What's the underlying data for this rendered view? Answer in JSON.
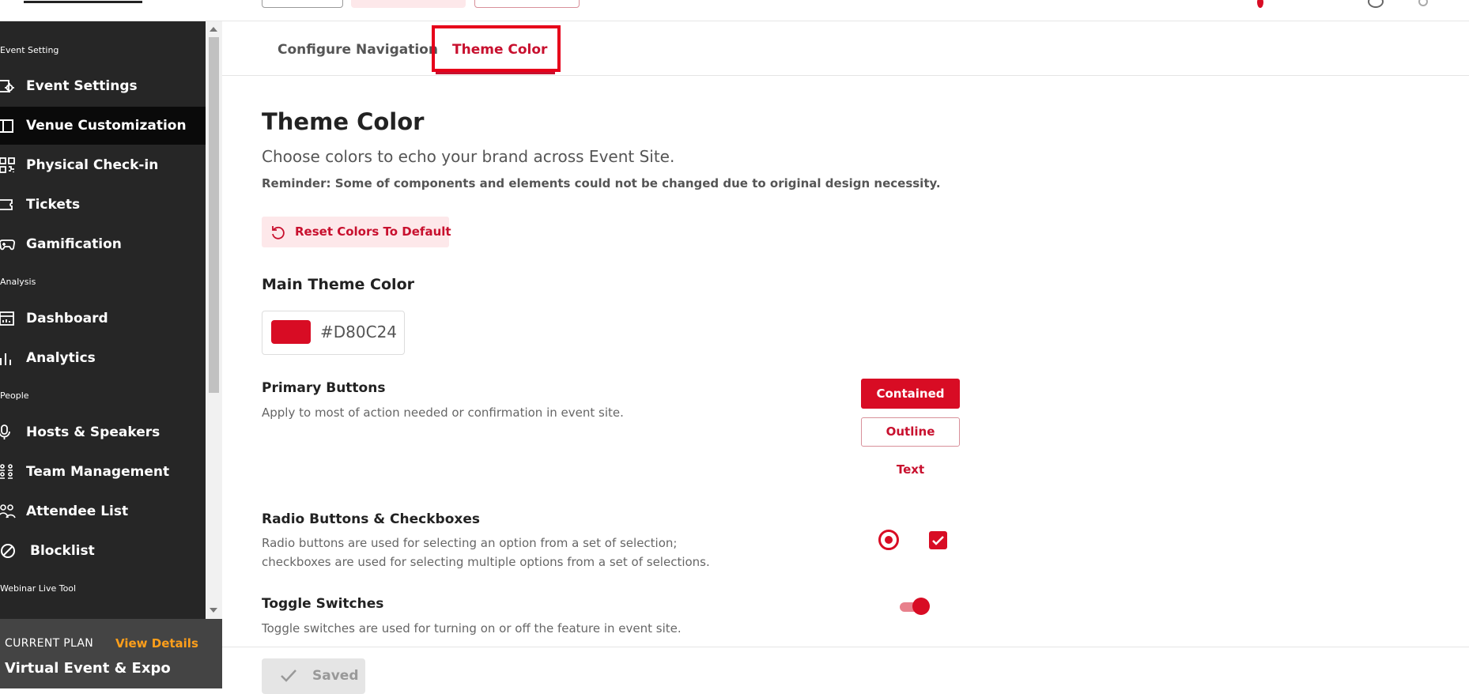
{
  "sidebar": {
    "sections": [
      {
        "label": "Event Setting"
      },
      {
        "label": "Analysis"
      },
      {
        "label": "People"
      },
      {
        "label": "Webinar Live Tool"
      }
    ],
    "items": [
      {
        "label": "Event Settings",
        "icon": "settings-calendar-icon"
      },
      {
        "label": "Venue Customization",
        "icon": "layout-icon",
        "active": true
      },
      {
        "label": "Physical Check-in",
        "icon": "qr-code-icon"
      },
      {
        "label": "Tickets",
        "icon": "ticket-icon"
      },
      {
        "label": "Gamification",
        "icon": "gamepad-icon"
      },
      {
        "label": "Dashboard",
        "icon": "dashboard-icon"
      },
      {
        "label": "Analytics",
        "icon": "bar-chart-icon"
      },
      {
        "label": "Hosts & Speakers",
        "icon": "microphone-icon"
      },
      {
        "label": "Team Management",
        "icon": "team-icon"
      },
      {
        "label": "Attendee List",
        "icon": "attendees-icon"
      },
      {
        "label": "Blocklist",
        "icon": "block-icon"
      }
    ]
  },
  "plan": {
    "current_label": "CURRENT PLAN",
    "view_details": "View Details",
    "name": "Virtual Event & Expo"
  },
  "tabs": [
    {
      "label": "Configure Navigation"
    },
    {
      "label": "Theme Color",
      "active": true
    }
  ],
  "main": {
    "title": "Theme Color",
    "subtitle": "Choose colors to echo your brand across Event Site.",
    "reminder": "Reminder: Some of components and elements could not be changed due to original design necessity.",
    "reset_button": "Reset Colors To Default",
    "main_theme_color": {
      "heading": "Main Theme Color",
      "hex": "#D80C24",
      "swatch_color": "#D80C24"
    },
    "primary_buttons": {
      "heading": "Primary Buttons",
      "description": "Apply to most of action needed or confirmation in event site.",
      "contained": "Contained",
      "outline": "Outline",
      "text": "Text"
    },
    "radio_checkboxes": {
      "heading": "Radio Buttons & Checkboxes",
      "description_line1": "Radio buttons are used for selecting an option from a set of selection;",
      "description_line2": "checkboxes are used for selecting multiple options from a set of selections."
    },
    "toggle_switches": {
      "heading": "Toggle Switches",
      "description": "Toggle switches are used for turning on or off the feature in event site."
    }
  },
  "footer": {
    "saved_button": "Saved"
  },
  "colors": {
    "accent": "#D80C24",
    "sidebar_bg": "#262626",
    "plan_view_details": "#FF9F1A"
  }
}
